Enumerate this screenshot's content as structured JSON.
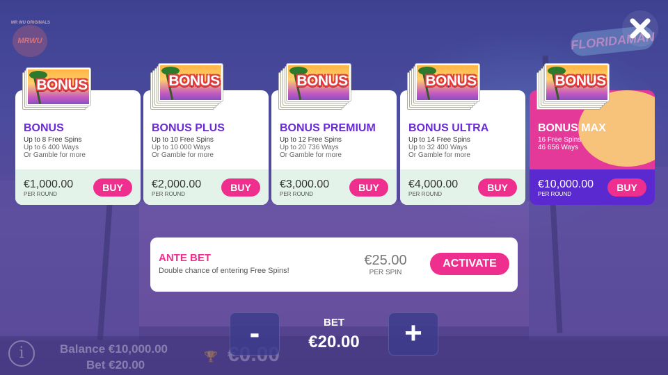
{
  "logo": {
    "top_text": "MR WU ORIGINALS",
    "text": "MRWU"
  },
  "sign": {
    "text": "FLORIDAMAN"
  },
  "close": {
    "icon": "close-icon"
  },
  "ticket_word": "BONUS",
  "cards": [
    {
      "title": "BONUS",
      "d1": "Up to 8 Free Spins",
      "d2": "Up to 6 400 Ways",
      "d3": "Or Gamble for more",
      "price": "€1,000.00",
      "per": "PER ROUND",
      "buy": "BUY"
    },
    {
      "title": "BONUS PLUS",
      "d1": "Up to 10 Free Spins",
      "d2": "Up to 10 000 Ways",
      "d3": "Or Gamble for more",
      "price": "€2,000.00",
      "per": "PER ROUND",
      "buy": "BUY"
    },
    {
      "title": "BONUS PREMIUM",
      "d1": "Up to 12 Free Spins",
      "d2": "Up to 20 736 Ways",
      "d3": "Or Gamble for more",
      "price": "€3,000.00",
      "per": "PER ROUND",
      "buy": "BUY"
    },
    {
      "title": "BONUS ULTRA",
      "d1": "Up to 14 Free Spins",
      "d2": "Up to 32 400 Ways",
      "d3": "Or Gamble for more",
      "price": "€4,000.00",
      "per": "PER ROUND",
      "buy": "BUY"
    },
    {
      "title": "BONUS MAX",
      "d1": "16 Free Spins",
      "d2": "46 656 Ways",
      "price": "€10,000.00",
      "per": "PER ROUND",
      "buy": "BUY"
    }
  ],
  "ante": {
    "title": "ANTE BET",
    "desc": "Double chance of entering Free Spins!",
    "value": "€25.00",
    "per": "PER SPIN",
    "activate": "ACTIVATE"
  },
  "footer": {
    "info": "i",
    "balance": "Balance  €10,000.00",
    "bet": "Bet  €20.00",
    "win": "€0.00",
    "minus": "-",
    "plus": "+",
    "bet_title": "BET",
    "bet_value": "€20.00"
  },
  "colors": {
    "accent": "#ee2f8e",
    "title": "#6a2bd6",
    "card_bottom": "#e4f3ea"
  }
}
